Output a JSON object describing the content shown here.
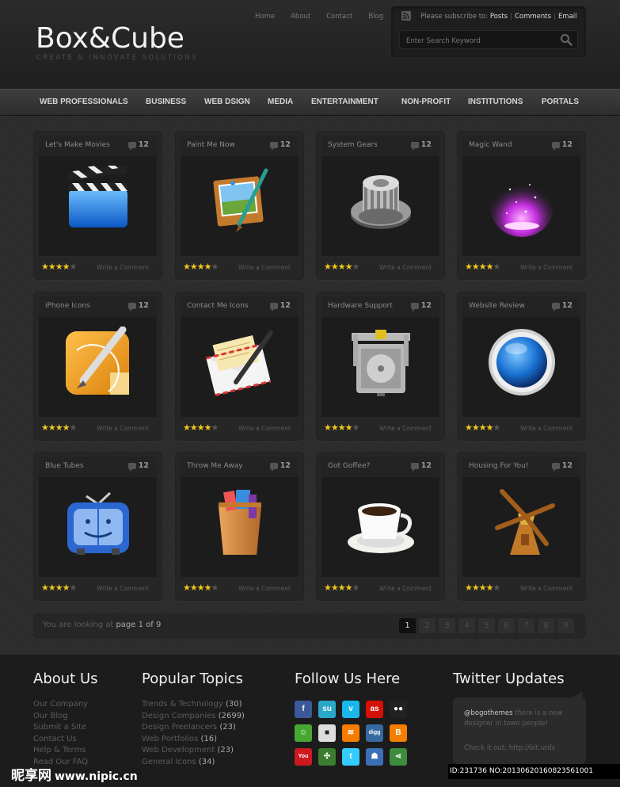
{
  "header": {
    "logo": "Box&Cube",
    "tagline": "CREATE & INNOVATE SOLUTIONS",
    "topnav": [
      "Home",
      "About",
      "Contact",
      "Blog"
    ],
    "subscribe_text": "Please subscribe to:",
    "subscribe_links": [
      "Posts",
      "Comments",
      "Email"
    ],
    "search_placeholder": "Enter Search Keyword"
  },
  "categories": [
    "WEB PROFESSIONALS",
    "BUSINESS",
    "WEB DSIGN",
    "MEDIA",
    "ENTERTAINMENT",
    "NON-PROFIT",
    "INSTITUTIONS",
    "PORTALS"
  ],
  "cards": [
    {
      "title": "Let's Make Movies",
      "count": "12",
      "icon": "clapperboard-icon",
      "rating": 4
    },
    {
      "title": "Paint Me Now",
      "count": "12",
      "icon": "paint-canvas-icon",
      "rating": 4
    },
    {
      "title": "System Gears",
      "count": "12",
      "icon": "gear-icon",
      "rating": 4
    },
    {
      "title": "Magic Wand",
      "count": "12",
      "icon": "magic-sparkle-icon",
      "rating": 4
    },
    {
      "title": "iPhone Icons",
      "count": "12",
      "icon": "pen-nib-icon",
      "rating": 4
    },
    {
      "title": "Contact Me Icons",
      "count": "12",
      "icon": "envelope-pen-icon",
      "rating": 4
    },
    {
      "title": "Hardware Support",
      "count": "12",
      "icon": "hard-drive-icon",
      "rating": 4
    },
    {
      "title": "Website Review",
      "count": "12",
      "icon": "speaker-orb-icon",
      "rating": 4
    },
    {
      "title": "Blue Tubes",
      "count": "12",
      "icon": "tv-finder-icon",
      "rating": 4
    },
    {
      "title": "Throw Me Away",
      "count": "12",
      "icon": "wastebasket-icon",
      "rating": 4
    },
    {
      "title": "Got Goffee?",
      "count": "12",
      "icon": "coffee-cup-icon",
      "rating": 4
    },
    {
      "title": "Housing For You!",
      "count": "12",
      "icon": "windmill-icon",
      "rating": 4
    }
  ],
  "card_action": "Write a Comment",
  "pagination": {
    "prefix": "You are looking at",
    "current": "page 1 of 9",
    "pages": [
      "1",
      "2",
      "3",
      "4",
      "5",
      "6",
      "7",
      "8",
      "9"
    ],
    "active_page": "1"
  },
  "footer": {
    "about_title": "About Us",
    "about_links": [
      "Our Company",
      "Our Blog",
      "Submit a Site",
      "Contact Us",
      "Help & Terms",
      "Read Our FAQ"
    ],
    "topics_title": "Popular Topics",
    "topics": [
      {
        "name": "Trends & Technology",
        "count": "(30)"
      },
      {
        "name": "Design Companies",
        "count": "(2699)"
      },
      {
        "name": "Design Freelancers",
        "count": "(23)"
      },
      {
        "name": "Web Portfolios",
        "count": "(16)"
      },
      {
        "name": "Web Development",
        "count": "(23)"
      },
      {
        "name": "General Icons",
        "count": "(34)"
      }
    ],
    "follow_title": "Follow Us Here",
    "social": [
      {
        "icon": "facebook-icon",
        "glyph": "f",
        "color": "#3b5998"
      },
      {
        "icon": "stumbleupon-icon",
        "glyph": "su",
        "color": "#2aa8c8"
      },
      {
        "icon": "vimeo-icon",
        "glyph": "v",
        "color": "#1ab7ea"
      },
      {
        "icon": "lastfm-icon",
        "glyph": "as",
        "color": "#d51007"
      },
      {
        "icon": "flickr-icon",
        "glyph": "●●",
        "color": "#222222"
      },
      {
        "icon": "chat-icon",
        "glyph": "☺",
        "color": "#46a832"
      },
      {
        "icon": "delicious-icon",
        "glyph": "■",
        "color": "#dddddd"
      },
      {
        "icon": "rss-icon",
        "glyph": "≋",
        "color": "#f57c00"
      },
      {
        "icon": "digg-icon",
        "glyph": "digg",
        "color": "#356aa0"
      },
      {
        "icon": "blogger-icon",
        "glyph": "B",
        "color": "#f57d00"
      },
      {
        "icon": "youtube-icon",
        "glyph": "You",
        "color": "#cc181e"
      },
      {
        "icon": "evernote-icon",
        "glyph": "✣",
        "color": "#3a7d2e"
      },
      {
        "icon": "twitter-icon",
        "glyph": "t",
        "color": "#33ccff"
      },
      {
        "icon": "myspace-icon",
        "glyph": "☗",
        "color": "#3b6fb6"
      },
      {
        "icon": "share-icon",
        "glyph": "⋖",
        "color": "#3d8b3d"
      }
    ],
    "twitter_title": "Twitter Updates",
    "tweet_handle": "@bogothemes",
    "tweet_text": "there is a new designer in town people!",
    "tweet_link": "Check it out: http://bit.urds"
  },
  "watermark": {
    "brand": "昵享网",
    "url": "www.nipic.cn",
    "id": "ID:231736 NO:20130620160823561001"
  },
  "colors": {
    "star": "#f2c81a",
    "background": "#2c2c2c",
    "accent_text": "#f0f0f0"
  }
}
